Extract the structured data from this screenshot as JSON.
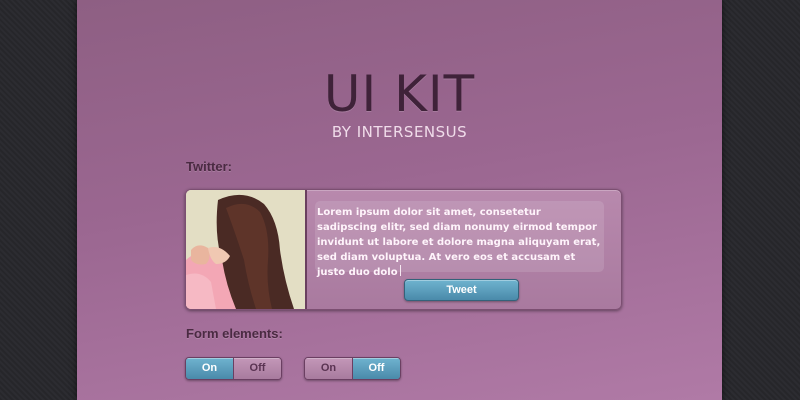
{
  "header": {
    "title": "UI KIT",
    "subtitle": "BY INTERSENSUS"
  },
  "twitter": {
    "section_label": "Twitter:",
    "tweet_text": "Lorem ipsum dolor sit amet, consetetur sadipscing elitr, sed diam nonumy eirmod tempor invidunt ut labore et dolore magna aliquyam erat, sed diam voluptua. At vero eos et accusam et justo duo dolo",
    "tweet_button_label": "Tweet"
  },
  "form": {
    "section_label": "Form elements:",
    "toggles": [
      {
        "on_label": "On",
        "off_label": "Off",
        "selected": "On"
      },
      {
        "on_label": "On",
        "off_label": "Off",
        "selected": "Off"
      }
    ]
  },
  "colors": {
    "panel": "#9b6791",
    "accent_blue": "#4a8aaa",
    "title_text": "#3f2239",
    "frame": "#2a2a2e"
  },
  "icons": {
    "profile_photo": "woman-portrait-photo"
  }
}
